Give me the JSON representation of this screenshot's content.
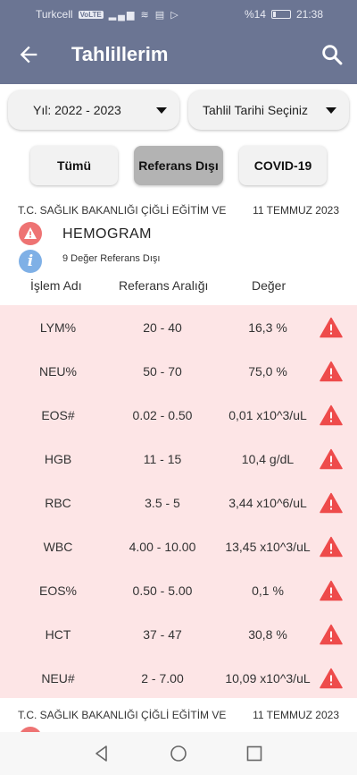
{
  "status_bar": {
    "carrier": "Turkcell",
    "network_badge": "VoLTE",
    "battery": "%14",
    "time": "21:38"
  },
  "header": {
    "title": "Tahlillerim"
  },
  "filters": {
    "year": "Yıl: 2022 - 2023",
    "date": "Tahlil Tarihi Seçiniz"
  },
  "tabs": [
    {
      "label": "Tümü"
    },
    {
      "label": "Referans Dışı"
    },
    {
      "label": "COVID-19"
    }
  ],
  "result": {
    "hospital": "T.C. SAĞLIK BAKANLIĞI ÇİĞLİ EĞİTİM VE",
    "date": "11 TEMMUZ 2023",
    "test_name": "HEMOGRAM",
    "out_of_range": "9 Değer Referans Dışı",
    "columns": [
      "İşlem Adı",
      "Referans Aralığı",
      "Değer"
    ],
    "rows": [
      {
        "name": "LYM%",
        "range": "20 - 40",
        "value": "16,3 %"
      },
      {
        "name": "NEU%",
        "range": "50 - 70",
        "value": "75,0 %"
      },
      {
        "name": "EOS#",
        "range": "0.02 - 0.50",
        "value": "0,01 x10^3/uL"
      },
      {
        "name": "HGB",
        "range": "11 - 15",
        "value": "10,4 g/dL"
      },
      {
        "name": "RBC",
        "range": "3.5 - 5",
        "value": "3,44 x10^6/uL"
      },
      {
        "name": "WBC",
        "range": "4.00 - 10.00",
        "value": "13,45 x10^3/uL"
      },
      {
        "name": "EOS%",
        "range": "0.50 - 5.00",
        "value": "0,1 %"
      },
      {
        "name": "HCT",
        "range": "37 - 47",
        "value": "30,8 %"
      },
      {
        "name": "NEU#",
        "range": "2 - 7.00",
        "value": "10,09 x10^3/uL"
      }
    ]
  },
  "next_result": {
    "hospital": "T.C. SAĞLIK BAKANLIĞI ÇİĞLİ EĞİTİM VE",
    "date": "11 TEMMUZ 2023"
  },
  "colors": {
    "appbar": "#6b7593",
    "row_background": "#fde5e6",
    "warning": "#ee4b4b",
    "alert_circle": "#ee7373",
    "info_circle": "#7fb0e6"
  },
  "icons": [
    "back-arrow-icon",
    "search-icon",
    "alert-icon",
    "info-icon",
    "warning-triangle-icon",
    "nav-back-icon",
    "nav-home-icon",
    "nav-recents-icon"
  ]
}
